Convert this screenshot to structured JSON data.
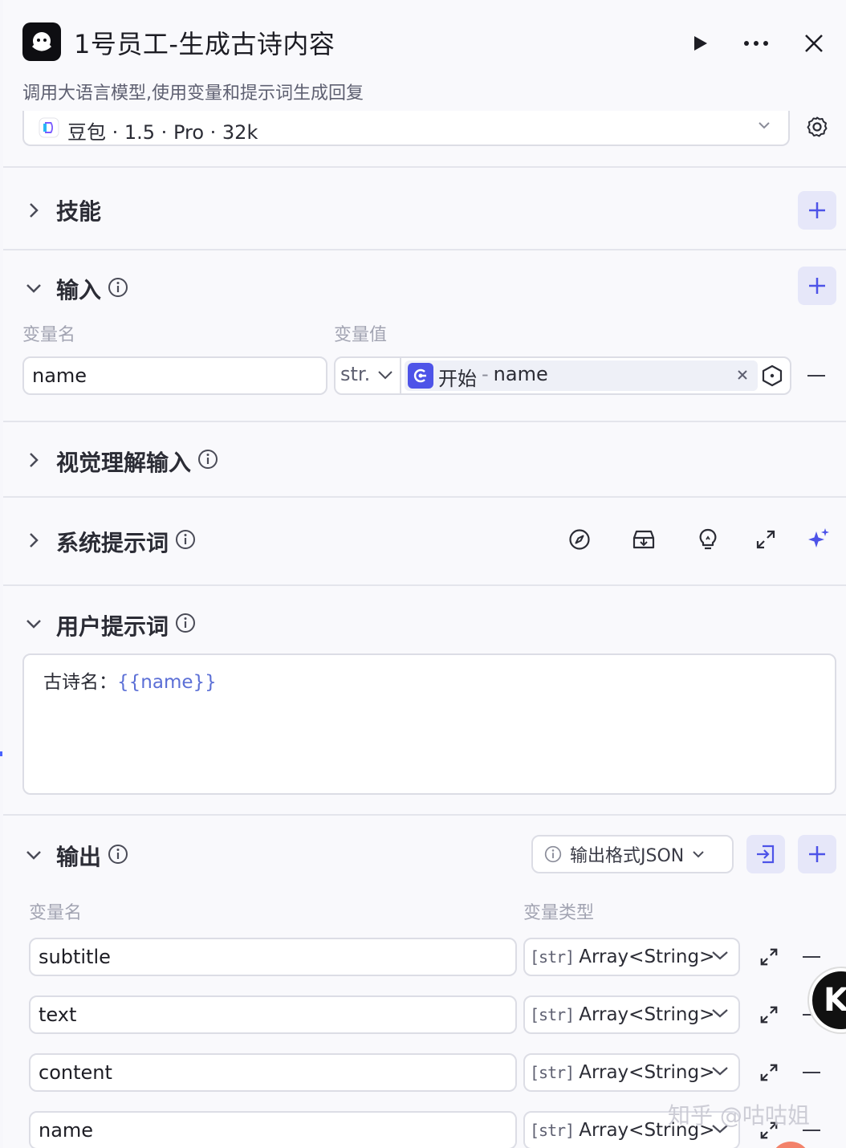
{
  "header": {
    "title": "1号员工-生成古诗内容",
    "description": "调用大语言模型,使用变量和提示词生成回复"
  },
  "model": {
    "label": "豆包 · 1.5 · Pro · 32k"
  },
  "sections": {
    "skills": {
      "title": "技能"
    },
    "input": {
      "title": "输入",
      "col_name": "变量名",
      "col_value": "变量值",
      "row": {
        "name": "name",
        "type": "str.",
        "ref_source": "开始",
        "ref_sep": "-",
        "ref_var": "name"
      }
    },
    "vision": {
      "title": "视觉理解输入"
    },
    "system_prompt": {
      "title": "系统提示词"
    },
    "user_prompt": {
      "title": "用户提示词",
      "prefix": "古诗名：",
      "variable": "{{name}}"
    },
    "output": {
      "title": "输出",
      "format_label": "输出格式JSON",
      "col_name": "变量名",
      "col_type": "变量类型",
      "rows": [
        {
          "name": "subtitle",
          "tag": "[str]",
          "type": "Array<String>"
        },
        {
          "name": "text",
          "tag": "[str]",
          "type": "Array<String>"
        },
        {
          "name": "content",
          "tag": "[str]",
          "type": "Array<String>"
        },
        {
          "name": "name",
          "tag": "[str]",
          "type": "Array<String>"
        }
      ]
    }
  },
  "overlay": {
    "watermark": "知乎 @咕咕姐",
    "badge_letter": "K"
  },
  "colors": {
    "accent": "#4d53e8",
    "variable_text": "#5b6fd6",
    "add_button_bg": "#e6e7f9"
  }
}
